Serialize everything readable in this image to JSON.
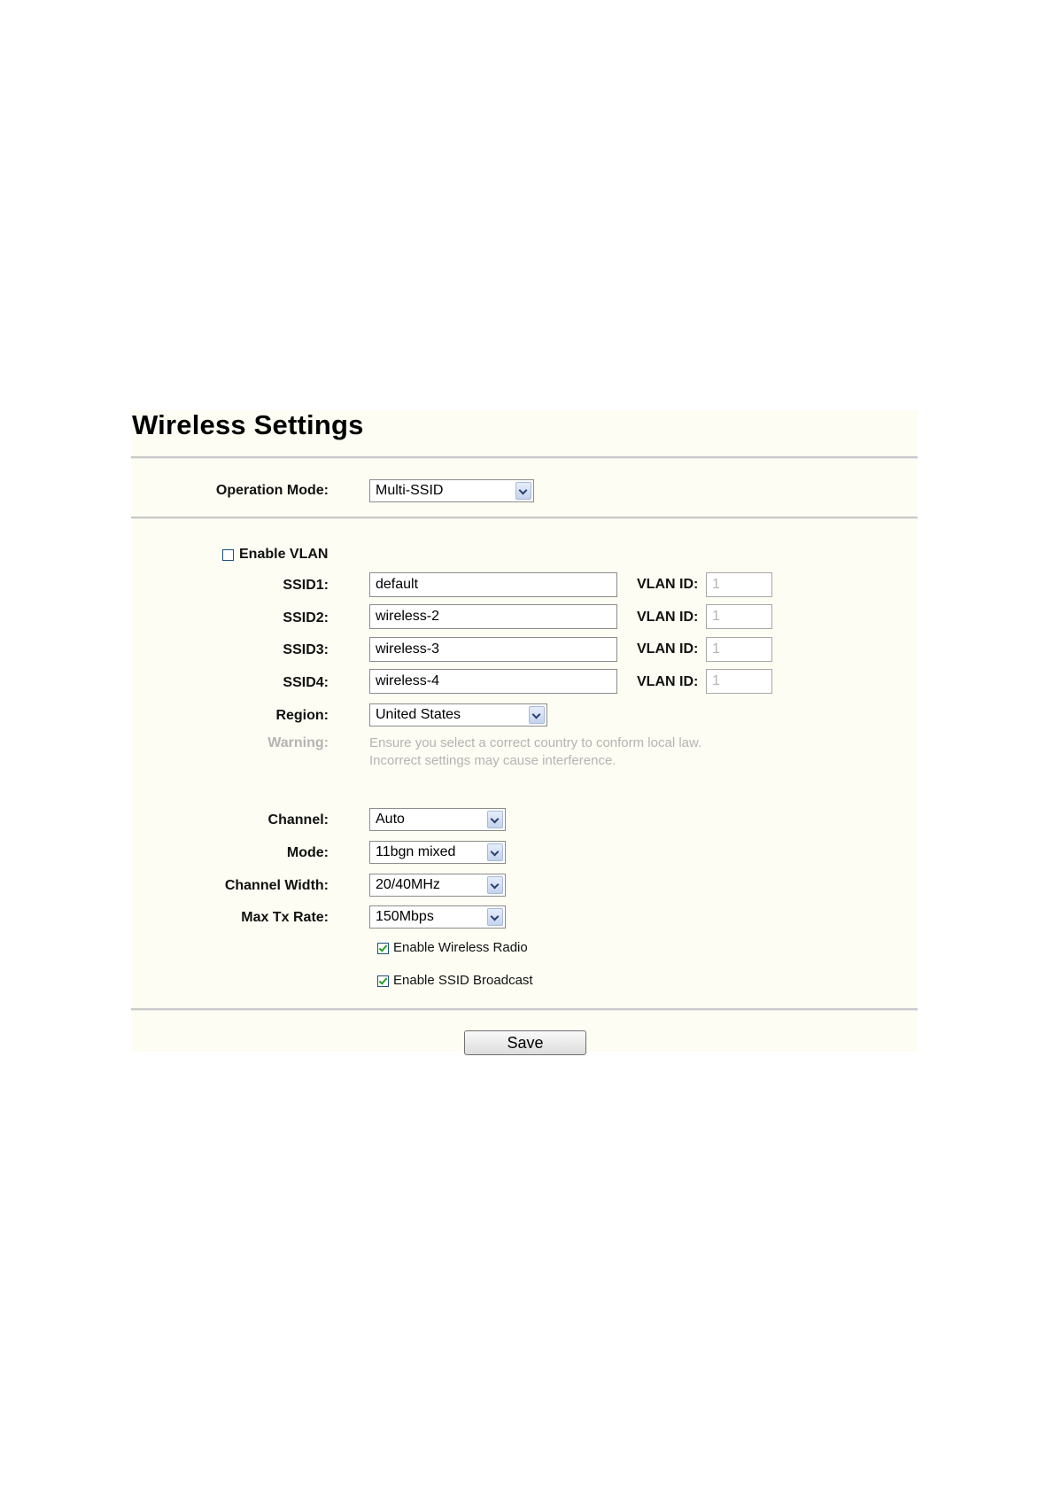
{
  "page": {
    "title": "Wireless Settings"
  },
  "operation_mode": {
    "label": "Operation Mode:",
    "value": "Multi-SSID"
  },
  "vlan": {
    "enable_label": "Enable VLAN",
    "enabled": false,
    "vlan_id_label": "VLAN ID:"
  },
  "ssids": [
    {
      "label": "SSID1:",
      "value": "default",
      "vlan_id": "1"
    },
    {
      "label": "SSID2:",
      "value": "wireless-2",
      "vlan_id": "1"
    },
    {
      "label": "SSID3:",
      "value": "wireless-3",
      "vlan_id": "1"
    },
    {
      "label": "SSID4:",
      "value": "wireless-4",
      "vlan_id": "1"
    }
  ],
  "region": {
    "label": "Region:",
    "value": "United States"
  },
  "warning": {
    "label": "Warning:",
    "line1": "Ensure you select a correct country to conform local law.",
    "line2": "Incorrect settings may cause interference."
  },
  "channel": {
    "label": "Channel:",
    "value": "Auto"
  },
  "mode": {
    "label": "Mode:",
    "value": "11bgn mixed"
  },
  "channel_width": {
    "label": "Channel Width:",
    "value": "20/40MHz"
  },
  "max_tx_rate": {
    "label": "Max Tx Rate:",
    "value": "150Mbps"
  },
  "options": {
    "wireless_radio_label": "Enable Wireless Radio",
    "wireless_radio_checked": true,
    "ssid_broadcast_label": "Enable SSID Broadcast",
    "ssid_broadcast_checked": true
  },
  "actions": {
    "save_label": "Save"
  }
}
